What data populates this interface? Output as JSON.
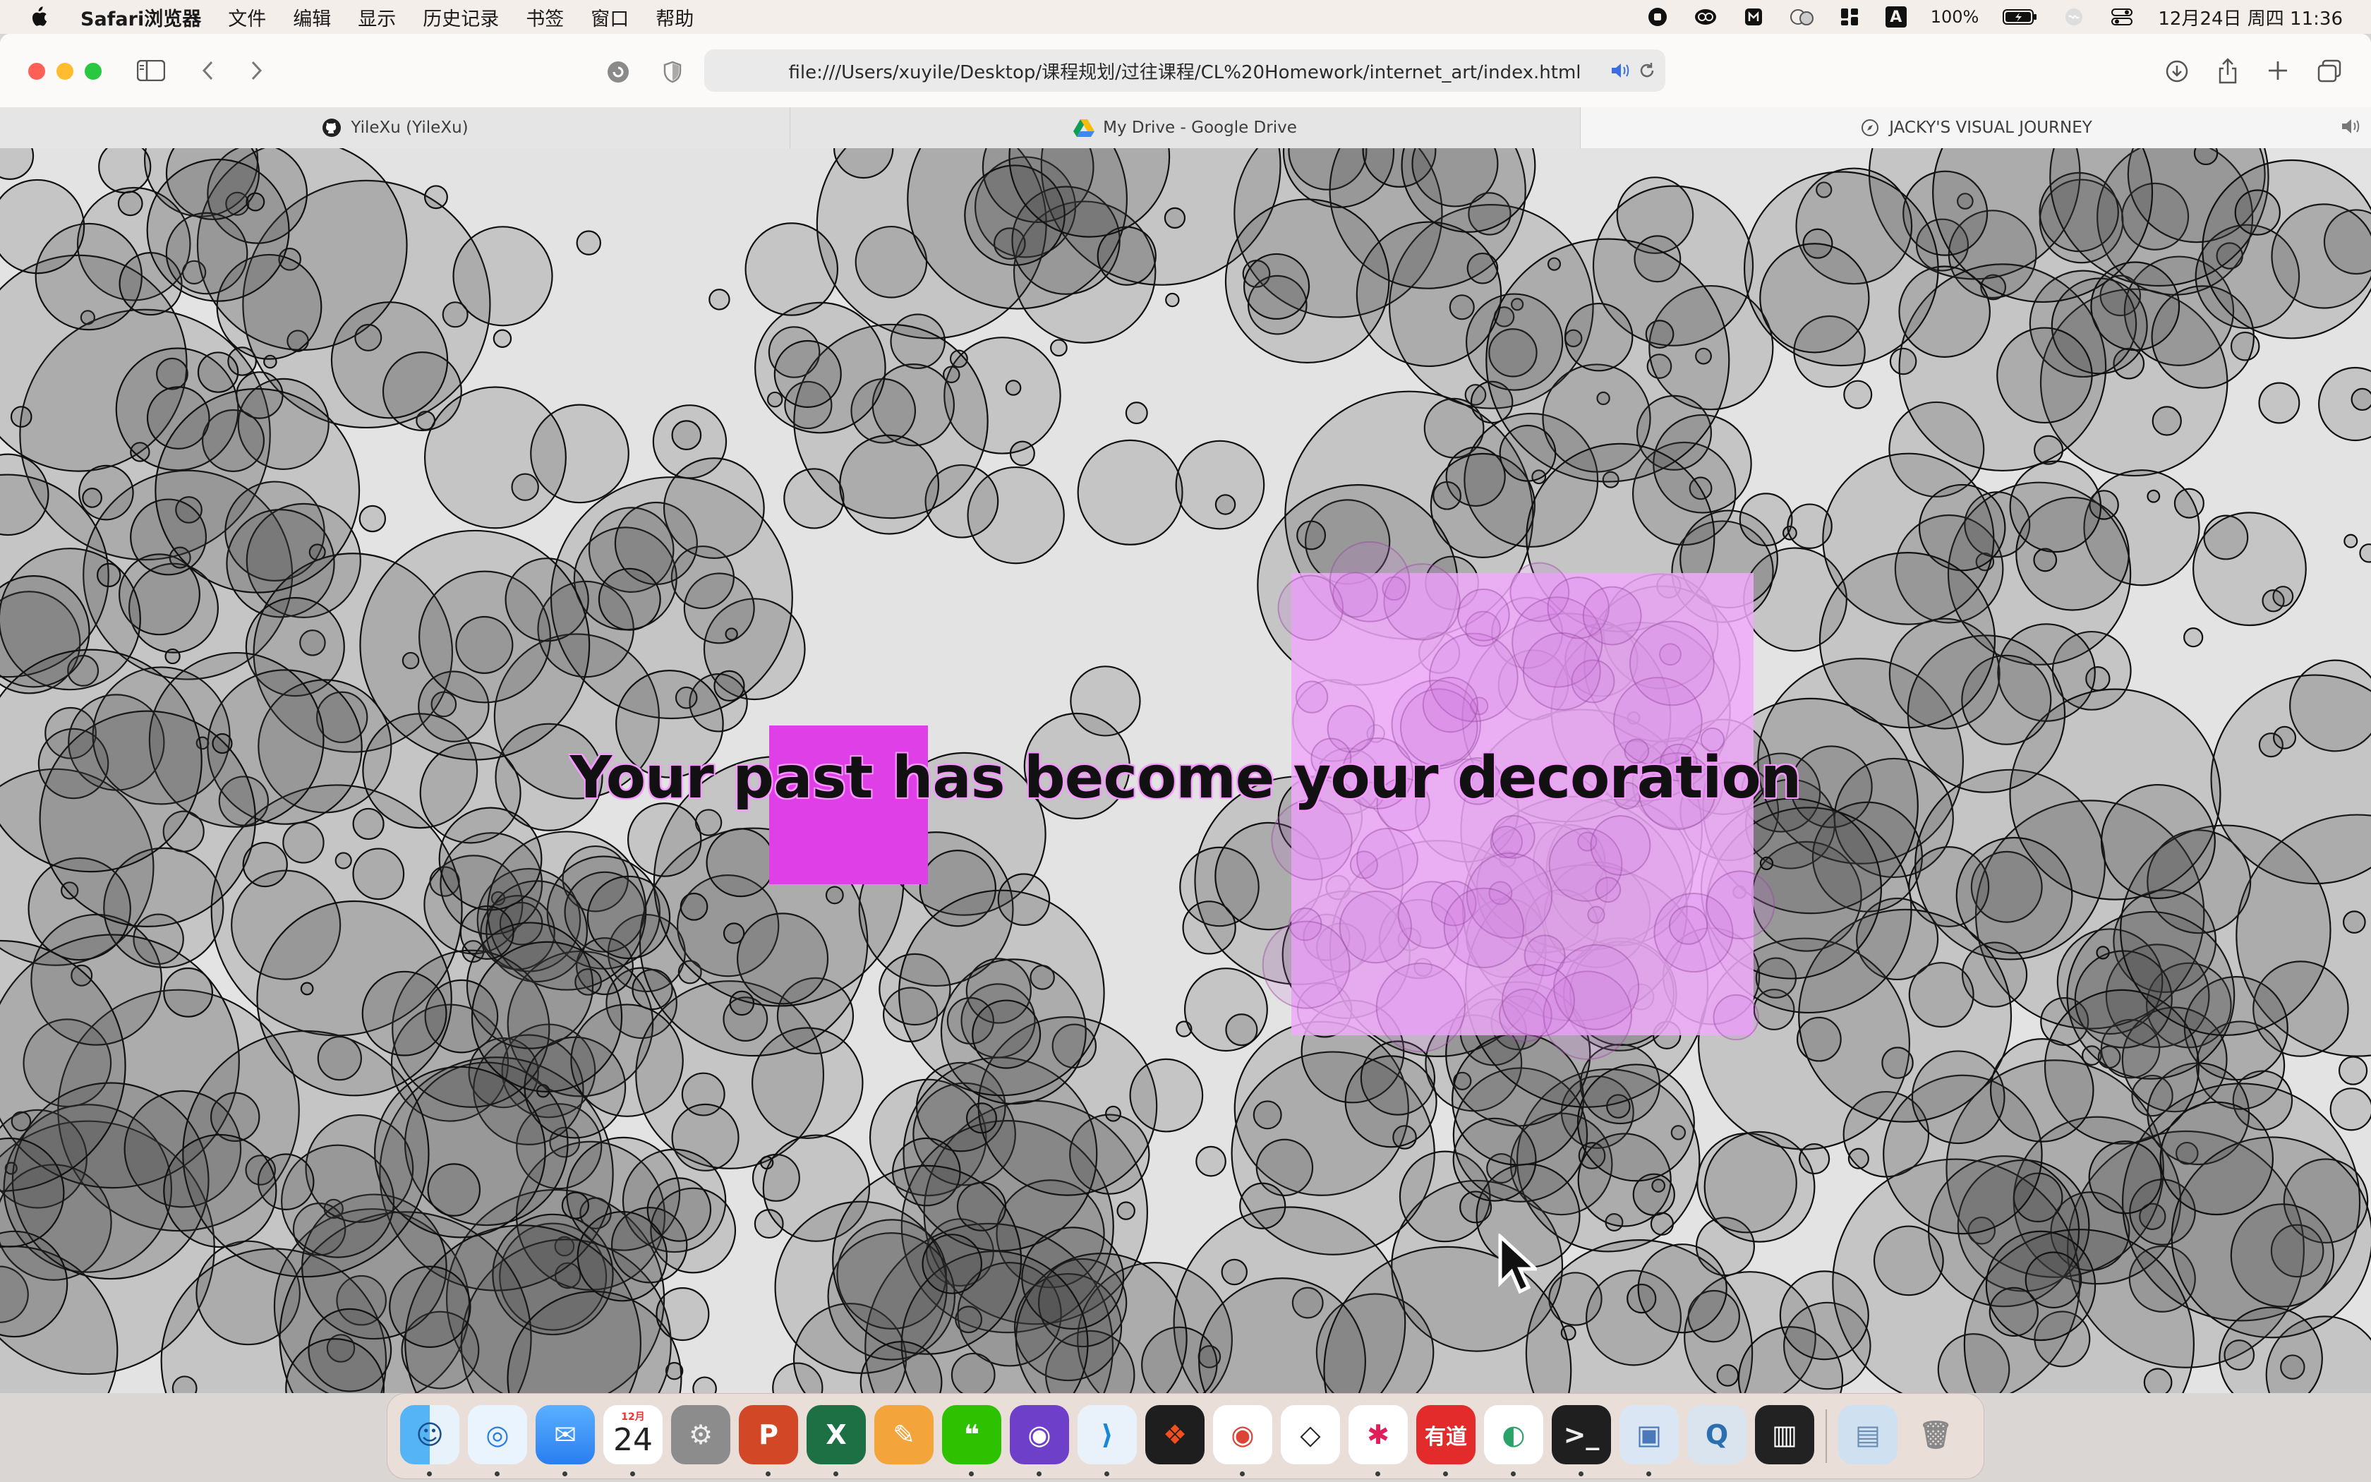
{
  "menubar": {
    "apple_icon": "apple-logo-icon",
    "app_name": "Safari浏览器",
    "items": [
      "文件",
      "编辑",
      "显示",
      "历史记录",
      "书签",
      "窗口",
      "帮助"
    ],
    "battery_percent": "100%",
    "datetime": "12月24日 周四  11:36",
    "input_method": "A"
  },
  "browser": {
    "url": "file:///Users/xuyile/Desktop/课程规划/过往课程/CL%20Homework/internet_art/index.html",
    "tabs": [
      {
        "label": "YileXu (YileXu)",
        "icon": "github-icon"
      },
      {
        "label": "My Drive - Google Drive",
        "icon": "google-drive-icon"
      },
      {
        "label": "JACKY'S VISUAL JOURNEY",
        "icon": "compass-icon"
      }
    ]
  },
  "page": {
    "headline": "Your past has become your decoration",
    "colors": {
      "background": "#e3e3e3",
      "circle_fill": "rgba(60,60,60,0.18)",
      "circle_stroke": "#111111",
      "magenta_square": "#df3fe6",
      "pink_square": "rgba(240,170,250,0.85)",
      "headline_glow": "#f3a6ff"
    }
  },
  "dock": {
    "calendar_month": "12月",
    "calendar_day": "24",
    "apps": [
      "finder",
      "safari",
      "mail",
      "calendar",
      "system-settings",
      "powerpoint",
      "excel",
      "pages",
      "wechat",
      "github-desktop",
      "vscode",
      "figma",
      "chrome",
      "unity",
      "slack",
      "youdao",
      "vpn",
      "terminal",
      "preview",
      "quicktime",
      "piano",
      "downloads",
      "trash"
    ],
    "youdao_label": "有道"
  }
}
